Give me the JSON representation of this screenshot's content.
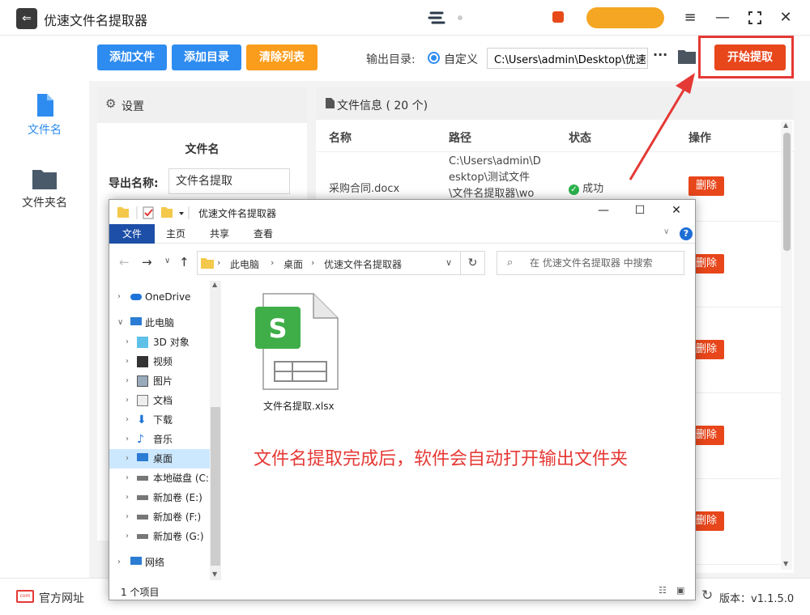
{
  "app": {
    "title": "优速文件名提取器",
    "window_buttons": [
      "menu-icon",
      "minimize-icon",
      "maximize-icon",
      "close-icon"
    ]
  },
  "sidebar": {
    "items": [
      {
        "label": "文件名",
        "icon": "file-icon",
        "active": true
      },
      {
        "label": "文件夹名",
        "icon": "folder-icon",
        "active": false
      }
    ]
  },
  "toolbar": {
    "add_file": "添加文件",
    "add_dir": "添加目录",
    "clear_list": "清除列表",
    "output_label": "输出目录:",
    "radio_label": "自定义",
    "output_path": "C:\\Users\\admin\\Desktop\\优速",
    "dots": "···",
    "start": "开始提取"
  },
  "settings": {
    "header": "设置",
    "subtitle": "文件名",
    "export_label": "导出名称:",
    "export_value": "文件名提取"
  },
  "fileinfo": {
    "header": "文件信息 ( 20 个)",
    "columns": [
      "名称",
      "路径",
      "状态",
      "操作"
    ],
    "rows": [
      {
        "name": "采购合同.docx",
        "path": [
          "C:\\Users\\admin\\D",
          "esktop\\测试文件",
          "\\文件名提取器\\wo"
        ],
        "status": "成功",
        "action": "删除"
      }
    ],
    "delete_label": "删除"
  },
  "statusbar": {
    "website": "官方网址",
    "version": "版本：v1.1.5.0"
  },
  "explorer": {
    "title": "优速文件名提取器",
    "tabs": [
      "文件",
      "主页",
      "共享",
      "查看"
    ],
    "breadcrumb": [
      "此电脑",
      "桌面",
      "优速文件名提取器"
    ],
    "search_placeholder": "在 优速文件名提取器 中搜索",
    "nav": [
      "OneDrive",
      "此电脑",
      "3D 对象",
      "视频",
      "图片",
      "文档",
      "下载",
      "音乐",
      "桌面",
      "本地磁盘 (C:)",
      "新加卷 (E:)",
      "新加卷 (F:)",
      "新加卷 (G:)",
      "网络"
    ],
    "file": {
      "name": "文件名提取.xlsx"
    },
    "status": "1 个项目"
  },
  "caption": "文件名提取完成后，软件会自动打开输出文件夹",
  "colors": {
    "accent_blue": "#2e8cf0",
    "accent_orange": "#fa9d1c",
    "danger": "#e8461b",
    "highlight": "#e53935",
    "excel_green": "#3fae49"
  }
}
